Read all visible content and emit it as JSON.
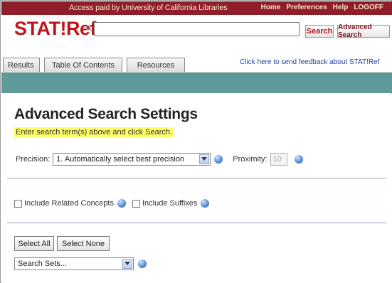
{
  "header": {
    "access_text": "Access paid by University of California Libraries",
    "links": [
      "Home",
      "Preferences",
      "Help",
      "LOGOFF"
    ],
    "logo": "STAT!Ref",
    "search": {
      "value": "",
      "placeholder": ""
    },
    "search_button": "Search",
    "advanced_search": "Advanced Search",
    "tabs": [
      "Results",
      "Table Of Contents",
      "Resources"
    ],
    "feedback": "Click here to send feedback about STAT!Ref"
  },
  "page": {
    "title": "Advanced Search Settings",
    "hint": "Enter search term(s) above and click Search."
  },
  "settings": {
    "precision_label": "Precision:",
    "precision_value": "1. Automatically select best precision",
    "proximity_label": "Proximity:",
    "proximity_value": "10",
    "related_concepts": "Include Related Concepts",
    "suffixes": "Include Suffixes",
    "select_all": "Select All",
    "select_none": "Select None",
    "search_sets": "Search Sets..."
  },
  "colors": {
    "topbar": "#8f1d2a",
    "logo_red": "#c0141c",
    "teal_band": "#5e9a9a",
    "highlight": "#ffff66"
  },
  "icons": [
    "magnifier-icon",
    "help-icon",
    "dropdown-arrow-icon"
  ]
}
